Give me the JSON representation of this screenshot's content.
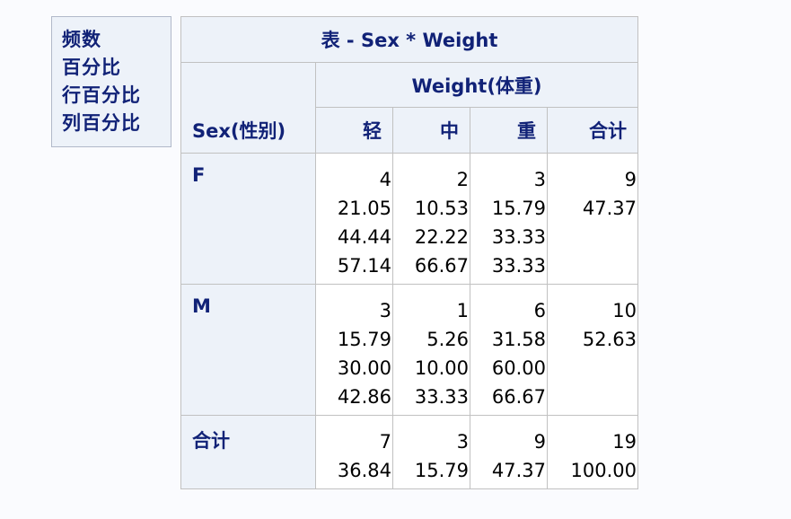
{
  "legend": {
    "lines": [
      "频数",
      "百分比",
      "行百分比",
      "列百分比"
    ]
  },
  "table": {
    "title": "表 - Sex * Weight",
    "col_group_label": "Weight(体重)",
    "row_header_label": "Sex(性别)",
    "columns": [
      "轻",
      "中",
      "重",
      "合计"
    ],
    "rows": [
      {
        "label": "F",
        "cells": [
          [
            "4",
            "21.05",
            "44.44",
            "57.14"
          ],
          [
            "2",
            "10.53",
            "22.22",
            "66.67"
          ],
          [
            "3",
            "15.79",
            "33.33",
            "33.33"
          ],
          [
            "9",
            "47.37"
          ]
        ]
      },
      {
        "label": "M",
        "cells": [
          [
            "3",
            "15.79",
            "30.00",
            "42.86"
          ],
          [
            "1",
            "5.26",
            "10.00",
            "33.33"
          ],
          [
            "6",
            "31.58",
            "60.00",
            "66.67"
          ],
          [
            "10",
            "52.63"
          ]
        ]
      },
      {
        "label": "合计",
        "cells": [
          [
            "7",
            "36.84"
          ],
          [
            "3",
            "15.79"
          ],
          [
            "9",
            "47.37"
          ],
          [
            "19",
            "100.00"
          ]
        ]
      }
    ]
  },
  "colors": {
    "header_bg": "#edf2f9",
    "header_text": "#112277",
    "border": "#c1c1c1",
    "page_bg": "#fafbfe"
  }
}
